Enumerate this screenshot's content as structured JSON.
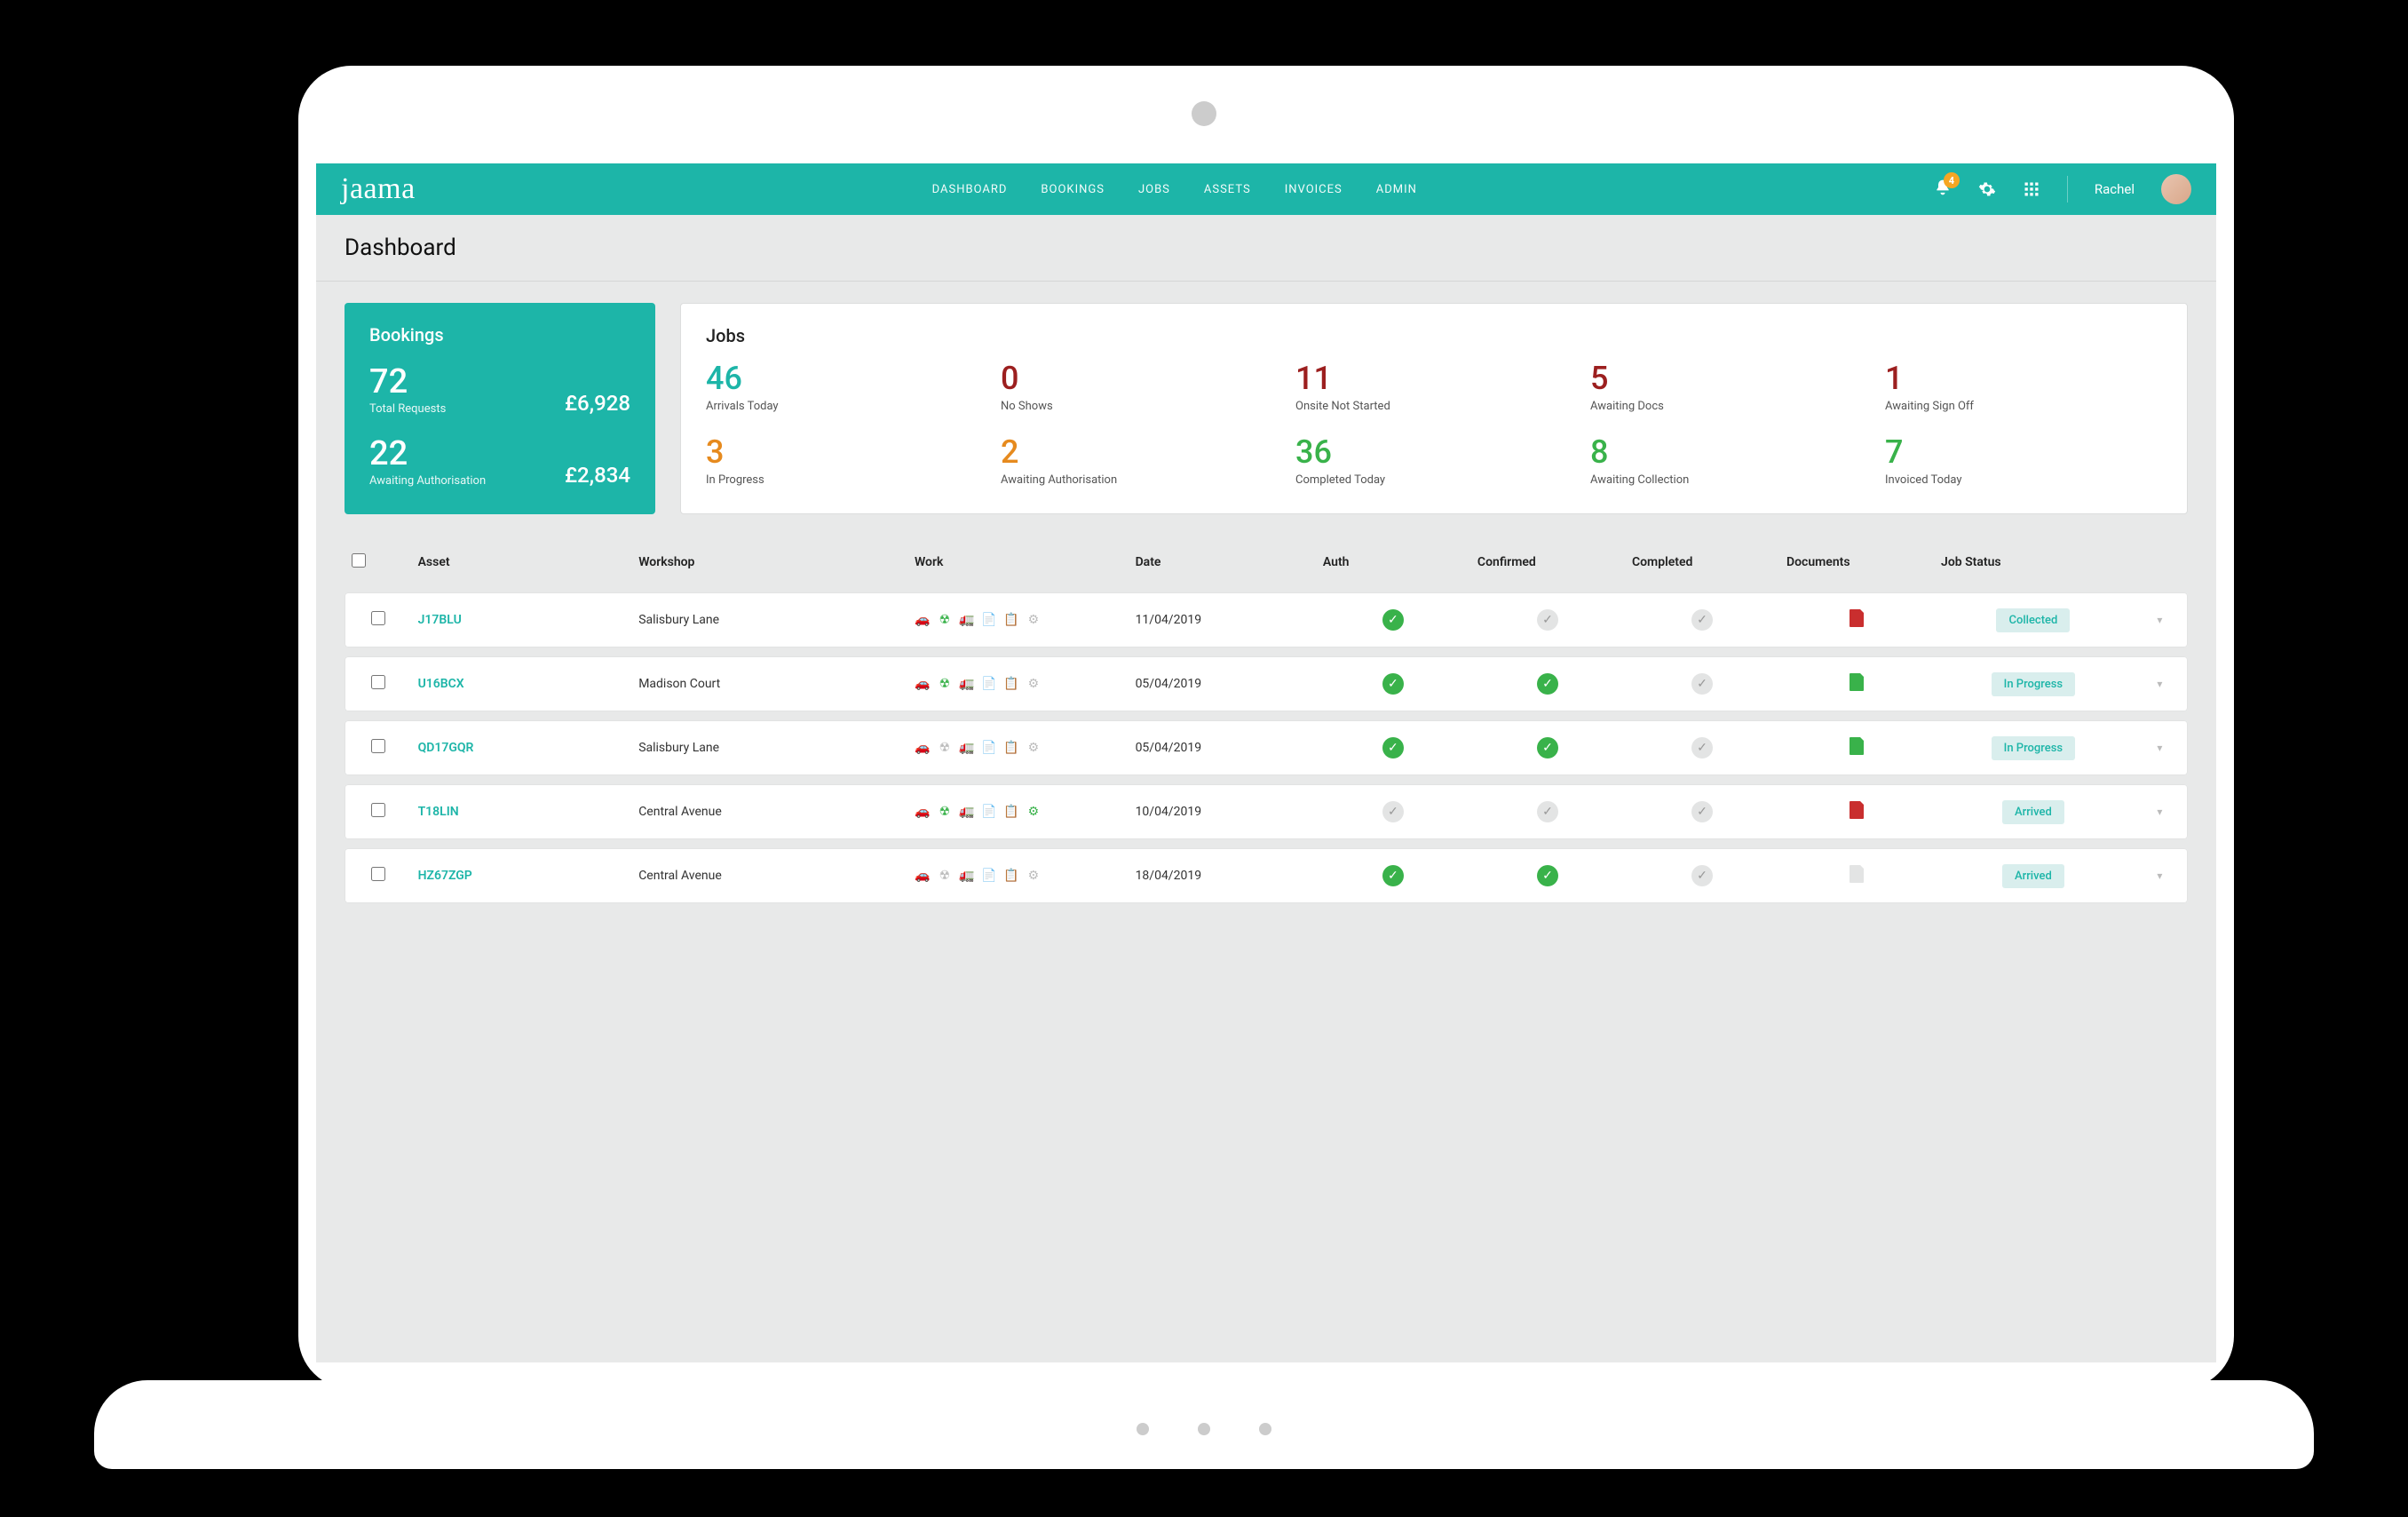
{
  "brand": "jaama",
  "nav": {
    "items": [
      "DASHBOARD",
      "BOOKINGS",
      "JOBS",
      "ASSETS",
      "INVOICES",
      "ADMIN"
    ],
    "notification_count": "4",
    "user_name": "Rachel"
  },
  "page_title": "Dashboard",
  "bookings_card": {
    "title": "Bookings",
    "total_requests_value": "72",
    "total_requests_label": "Total Requests",
    "total_requests_amount": "£6,928",
    "awaiting_auth_value": "22",
    "awaiting_auth_label": "Awaiting Authorisation",
    "awaiting_auth_amount": "£2,834"
  },
  "jobs_card": {
    "title": "Jobs",
    "stats": [
      {
        "value": "46",
        "label": "Arrivals Today",
        "color": "c-teal"
      },
      {
        "value": "0",
        "label": "No Shows",
        "color": "c-red"
      },
      {
        "value": "11",
        "label": "Onsite Not Started",
        "color": "c-red"
      },
      {
        "value": "5",
        "label": "Awaiting Docs",
        "color": "c-red"
      },
      {
        "value": "1",
        "label": "Awaiting Sign Off",
        "color": "c-red"
      },
      {
        "value": "3",
        "label": "In Progress",
        "color": "c-orange"
      },
      {
        "value": "2",
        "label": "Awaiting Authorisation",
        "color": "c-orange"
      },
      {
        "value": "36",
        "label": "Completed Today",
        "color": "c-green"
      },
      {
        "value": "8",
        "label": "Awaiting Collection",
        "color": "c-green"
      },
      {
        "value": "7",
        "label": "Invoiced Today",
        "color": "c-green"
      }
    ]
  },
  "table": {
    "headers": {
      "asset": "Asset",
      "workshop": "Workshop",
      "work": "Work",
      "date": "Date",
      "auth": "Auth",
      "confirmed": "Confirmed",
      "completed": "Completed",
      "documents": "Documents",
      "status": "Job Status"
    },
    "rows": [
      {
        "asset": "J17BLU",
        "workshop": "Salisbury Lane",
        "date": "11/04/2019",
        "auth": "green",
        "confirmed": "gray",
        "completed": "gray",
        "documents": "red",
        "status": "Collected",
        "work": [
          "on",
          "on",
          "off",
          "off",
          "off",
          "off"
        ]
      },
      {
        "asset": "U16BCX",
        "workshop": "Madison Court",
        "date": "05/04/2019",
        "auth": "green",
        "confirmed": "green",
        "completed": "gray",
        "documents": "green",
        "status": "In Progress",
        "work": [
          "on",
          "on",
          "off",
          "off",
          "off",
          "off"
        ]
      },
      {
        "asset": "QD17GQR",
        "workshop": "Salisbury Lane",
        "date": "05/04/2019",
        "auth": "green",
        "confirmed": "green",
        "completed": "gray",
        "documents": "green",
        "status": "In Progress",
        "work": [
          "off",
          "off",
          "off",
          "off",
          "on",
          "off"
        ]
      },
      {
        "asset": "T18LIN",
        "workshop": "Central Avenue",
        "date": "10/04/2019",
        "auth": "gray",
        "confirmed": "gray",
        "completed": "gray",
        "documents": "red",
        "status": "Arrived",
        "work": [
          "off",
          "on",
          "off",
          "off",
          "off",
          "on"
        ]
      },
      {
        "asset": "HZ67ZGP",
        "workshop": "Central Avenue",
        "date": "18/04/2019",
        "auth": "green",
        "confirmed": "green",
        "completed": "gray",
        "documents": "gray",
        "status": "Arrived",
        "work": [
          "off",
          "off",
          "off",
          "off",
          "off",
          "off"
        ]
      }
    ]
  }
}
